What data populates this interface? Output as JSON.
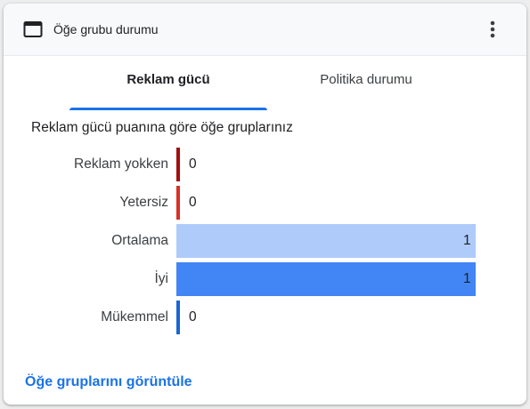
{
  "header": {
    "title": "Öğe grubu durumu",
    "icon": "window-icon",
    "more_icon": "more-vert-icon"
  },
  "tabs": [
    {
      "label": "Reklam gücü",
      "active": true
    },
    {
      "label": "Politika durumu",
      "active": false
    }
  ],
  "subtitle": "Reklam gücü puanına göre öğe gruplarınız",
  "chart_data": {
    "type": "bar",
    "orientation": "horizontal",
    "categories": [
      "Reklam yokken",
      "Yetersiz",
      "Ortalama",
      "İyi",
      "Mükemmel"
    ],
    "values": [
      0,
      0,
      1,
      1,
      0
    ],
    "colors": [
      "#a50e0e",
      "#d93025",
      "#aecbfa",
      "#4285f4",
      "#1967d2"
    ]
  },
  "footer": {
    "link_label": "Öğe gruplarını görüntüle"
  }
}
